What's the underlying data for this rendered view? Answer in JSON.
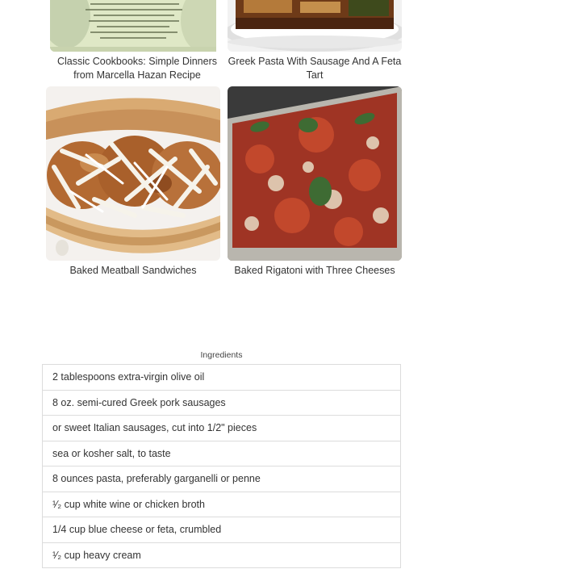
{
  "recipes": [
    {
      "title": "Classic Cookbooks: Simple Dinners from Marcella Hazan Recipe"
    },
    {
      "title": "Greek Pasta With Sausage And A Feta Tart"
    },
    {
      "title": "Baked Meatball Sandwiches"
    },
    {
      "title": "Baked Rigatoni with Three Cheeses"
    }
  ],
  "ingredients": {
    "title": "Ingredients",
    "items": [
      "2 tablespoons extra-virgin olive oil",
      "8 oz. semi-cured Greek pork sausages",
      "or sweet Italian sausages, cut into 1/2\" pieces",
      "sea or kosher salt, to taste",
      "8 ounces pasta, preferably garganelli or penne",
      "¹⁄₂ cup white wine or chicken broth",
      "1/4 cup blue cheese or feta, crumbled",
      "¹⁄₂ cup heavy cream"
    ]
  }
}
